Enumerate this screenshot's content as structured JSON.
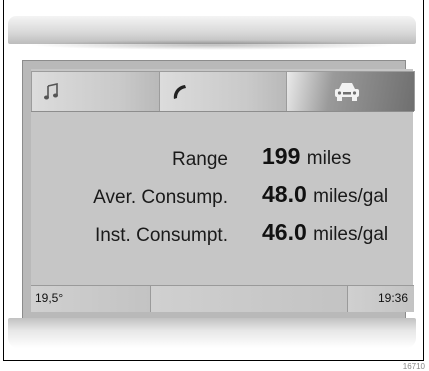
{
  "tabs": [
    {
      "name": "music",
      "icon": "music-note-icon"
    },
    {
      "name": "phone",
      "icon": "phone-handset-icon"
    },
    {
      "name": "vehicle",
      "icon": "car-icon",
      "active": true
    }
  ],
  "trip": {
    "range": {
      "label": "Range",
      "value": "199",
      "unit": "miles"
    },
    "average": {
      "label": "Aver. Consump.",
      "value": "48.0",
      "unit": "miles/gal"
    },
    "instant": {
      "label": "Inst. Consumpt.",
      "value": "46.0",
      "unit": "miles/gal"
    }
  },
  "status": {
    "temperature": "19,5°",
    "time": "19:36"
  },
  "figure_number": "16710"
}
